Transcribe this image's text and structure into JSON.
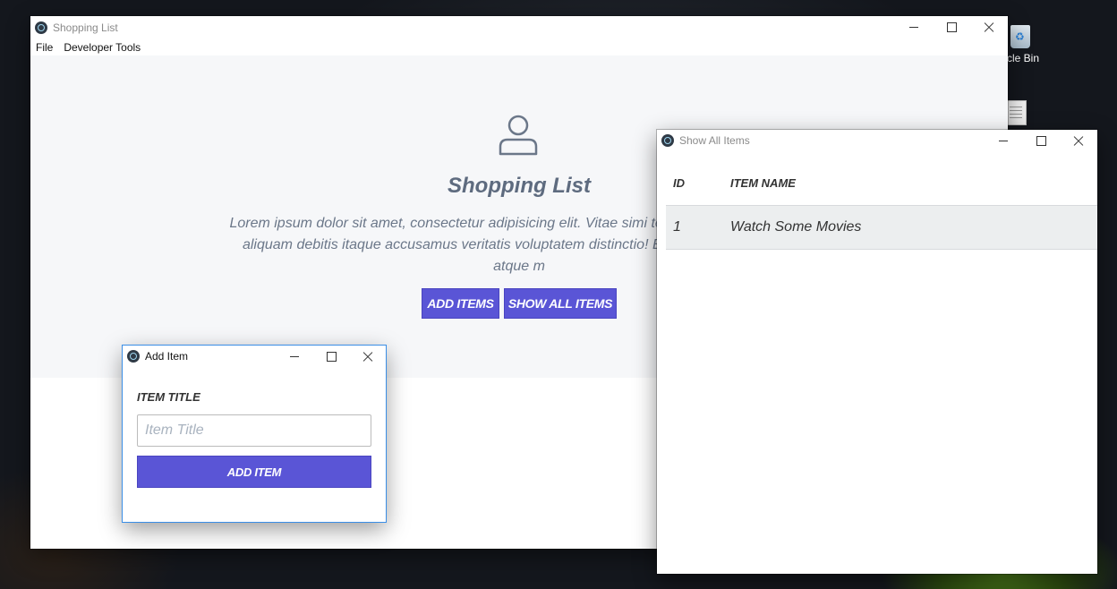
{
  "desktop": {
    "icons": [
      {
        "label": "Recycle Bin",
        "visible_label": "ycle Bin"
      },
      {
        "label": ""
      }
    ]
  },
  "main_window": {
    "title": "Shopping List",
    "menu": [
      "File",
      "Developer Tools"
    ],
    "hero": {
      "heading": "Shopping List",
      "paragraph": "Lorem ipsum dolor sit amet, consectetur adipisicing elit. Vitae simi temporibus ratione libero aliquam debitis itaque accusamus veritatis voluptatem distinctio! Exercitationem harum, atque m",
      "buttons": {
        "add_items": "ADD ITEMS",
        "show_all_items": "SHOW ALL ITEMS"
      }
    }
  },
  "add_item_window": {
    "title": "Add Item",
    "field_label": "ITEM TITLE",
    "input_placeholder": "Item Title",
    "input_value": "",
    "submit_label": "ADD ITEM"
  },
  "list_window": {
    "title": "Show All Items",
    "columns": [
      "ID",
      "ITEM NAME"
    ],
    "rows": [
      {
        "id": "1",
        "name": "Watch Some Movies"
      }
    ]
  },
  "colors": {
    "accent": "#5a55d6",
    "hero_bg": "#f6f7f9",
    "text_muted": "#6b7789",
    "row_bg": "#eceeef"
  }
}
